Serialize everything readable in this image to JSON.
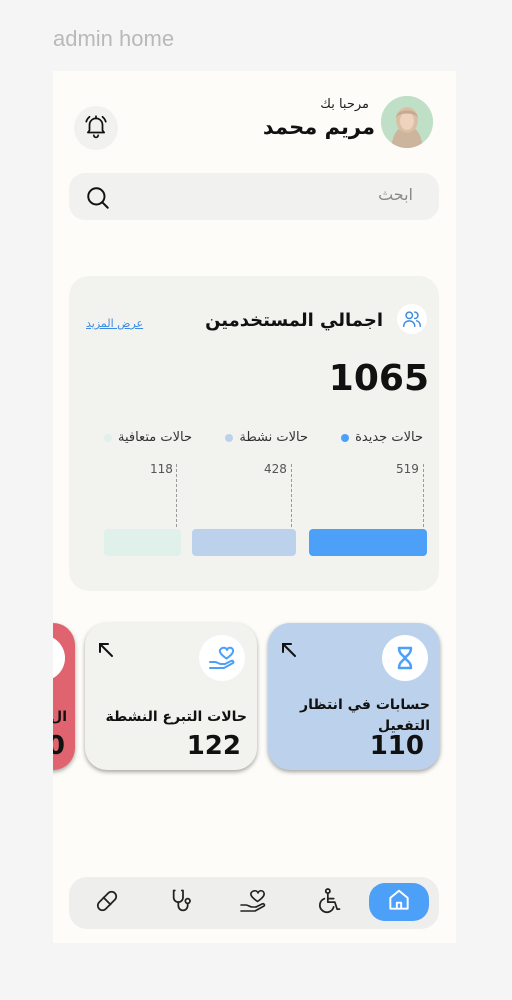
{
  "frame_title": "admin home",
  "header": {
    "greeting": "مرحبا بك",
    "user_name": "مريم محمد"
  },
  "search": {
    "placeholder": "ابحث"
  },
  "users_card": {
    "title": "اجمالي المستخدمين",
    "see_more": "عرض المزيد",
    "total": "1065",
    "legend": [
      {
        "label": "حالات جديدة",
        "color": "#4da0f8"
      },
      {
        "label": "حالات نشطة",
        "color": "#bcd1ec"
      },
      {
        "label": "حالات متعافية",
        "color": "#e0f0ea"
      }
    ],
    "bars": [
      {
        "value": "519",
        "color": "#4da0f8"
      },
      {
        "value": "428",
        "color": "#bcd1ec"
      },
      {
        "value": "118",
        "color": "#e0f0ea"
      }
    ]
  },
  "stat_cards": [
    {
      "label": "حسابات في انتظار التفعيل",
      "value": "110",
      "icon": "hourglass-icon",
      "color": "#bcd1ec"
    },
    {
      "label": "حالات التبرع النشطة",
      "value": "122",
      "icon": "donation-hand-icon",
      "color": "#f2f2ef"
    },
    {
      "label": "ال",
      "value": "0",
      "icon": "card-icon",
      "color": "#e06470"
    }
  ],
  "nav": [
    {
      "icon": "home-icon",
      "active": true
    },
    {
      "icon": "wheelchair-icon"
    },
    {
      "icon": "donation-hand-icon"
    },
    {
      "icon": "stethoscope-icon"
    },
    {
      "icon": "pill-icon"
    }
  ]
}
